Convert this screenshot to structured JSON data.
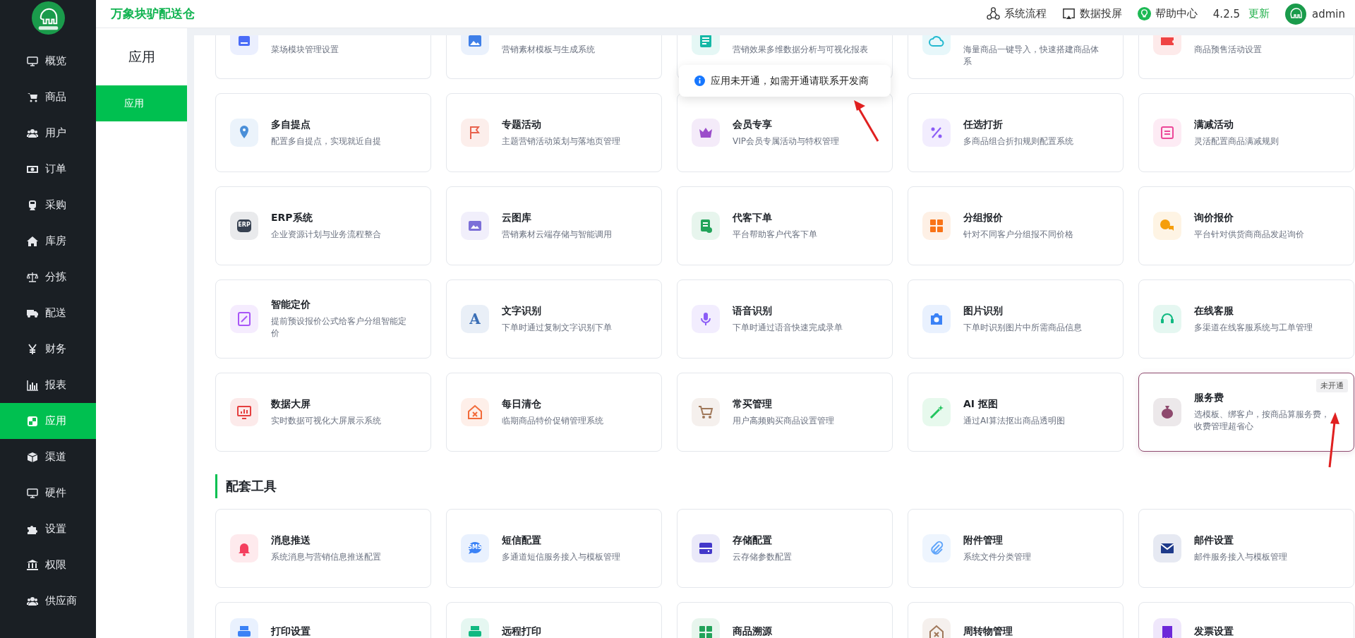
{
  "brand": {
    "title": "万象块驴配送仓"
  },
  "topbar": {
    "links": [
      {
        "label": "系统流程"
      },
      {
        "label": "数据投屏"
      },
      {
        "label": "帮助中心"
      }
    ],
    "version": "4.2.5",
    "update": "更新",
    "user": "admin"
  },
  "sidebar": {
    "items": [
      {
        "label": "概览",
        "selected": false
      },
      {
        "label": "商品",
        "selected": false
      },
      {
        "label": "用户",
        "selected": false
      },
      {
        "label": "订单",
        "selected": false
      },
      {
        "label": "采购",
        "selected": false
      },
      {
        "label": "库房",
        "selected": false
      },
      {
        "label": "分拣",
        "selected": false
      },
      {
        "label": "配送",
        "selected": false
      },
      {
        "label": "财务",
        "selected": false
      },
      {
        "label": "报表",
        "selected": false
      },
      {
        "label": "应用",
        "selected": true
      },
      {
        "label": "渠道",
        "selected": false
      },
      {
        "label": "硬件",
        "selected": false
      },
      {
        "label": "设置",
        "selected": false
      },
      {
        "label": "权限",
        "selected": false
      },
      {
        "label": "供应商",
        "selected": false
      }
    ]
  },
  "subnav": {
    "title": "应用",
    "items": [
      {
        "label": "应用",
        "selected": true
      }
    ]
  },
  "sections": [
    {
      "cards": [
        {
          "description": "菜场模块管理设置",
          "color": "#4a6cf7",
          "clipped": true,
          "highlighted": false
        },
        {
          "description": "营销素材模板与生成系统",
          "color": "#3f7fe8",
          "clipped": true,
          "highlighted": false
        },
        {
          "description": "营销效果多维数据分析与可视化报表",
          "color": "#14b8a6",
          "clipped": true,
          "highlighted": false
        },
        {
          "description": "海量商品一键导入，快速搭建商品体系",
          "color": "#22b8cf",
          "clipped": true,
          "highlighted": false
        },
        {
          "description": "商品预售活动设置",
          "color": "#ef4444",
          "clipped": true,
          "highlighted": false
        },
        {
          "title": "多自提点",
          "description": "配置多自提点，实现就近自提",
          "color": "#4a8fd8",
          "clipped": false,
          "highlighted": false
        },
        {
          "title": "专题活动",
          "description": "主题营销活动策划与落地页管理",
          "color": "#e8614c",
          "clipped": false,
          "highlighted": false
        },
        {
          "title": "会员专享",
          "description": "VIP会员专属活动与特权管理",
          "color": "#9b4dca",
          "clipped": false,
          "highlighted": false
        },
        {
          "title": "任选打折",
          "description": "多商品组合折扣规则配置系统",
          "color": "#8b5cf6",
          "clipped": false,
          "highlighted": false
        },
        {
          "title": "满减活动",
          "description": "灵活配置商品满减规则",
          "color": "#ec4899",
          "clipped": false,
          "highlighted": false
        },
        {
          "title": "ERP系统",
          "description": "企业资源计划与业务流程整合",
          "color": "#374151",
          "icon_text": "ERP",
          "clipped": false,
          "highlighted": false
        },
        {
          "title": "云图库",
          "description": "营销素材云端存储与智能调用",
          "color": "#7c6fd8",
          "clipped": false,
          "highlighted": false
        },
        {
          "title": "代客下单",
          "description": "平台帮助客户代客下单",
          "color": "#22a35a",
          "clipped": false,
          "highlighted": false
        },
        {
          "title": "分组报价",
          "description": "针对不同客户分组报不同价格",
          "color": "#f97316",
          "clipped": false,
          "highlighted": false
        },
        {
          "title": "询价报价",
          "description": "平台针对供货商商品发起询价",
          "color": "#f59e0b",
          "clipped": false,
          "highlighted": false
        },
        {
          "title": "智能定价",
          "description": "提前预设报价公式给客户分组智能定价",
          "color": "#a855f7",
          "clipped": false,
          "highlighted": false
        },
        {
          "title": "文字识别",
          "description": "下单时通过复制文字识别下单",
          "color": "#3b6fb6",
          "icon_text": "A",
          "clipped": false,
          "highlighted": false
        },
        {
          "title": "语音识别",
          "description": "下单时通过语音快速完成录单",
          "color": "#8b5cf6",
          "clipped": false,
          "highlighted": false
        },
        {
          "title": "图片识别",
          "description": "下单时识别图片中所需商品信息",
          "color": "#3b82f6",
          "clipped": false,
          "highlighted": false
        },
        {
          "title": "在线客服",
          "description": "多渠道在线客服系统与工单管理",
          "color": "#10b981",
          "clipped": false,
          "highlighted": false
        },
        {
          "title": "数据大屏",
          "description": "实时数据可视化大屏展示系统",
          "color": "#e53e3e",
          "clipped": false,
          "highlighted": false
        },
        {
          "title": "每日清仓",
          "description": "临期商品特价促销管理系统",
          "color": "#f26b3a",
          "clipped": false,
          "highlighted": false
        },
        {
          "title": "常买管理",
          "description": "用户高频购买商品设置管理",
          "color": "#a0785a",
          "clipped": false,
          "highlighted": false
        },
        {
          "title": "AI 抠图",
          "description": "通过AI算法抠出商品透明图",
          "color": "#22c55e",
          "clipped": false,
          "highlighted": false
        },
        {
          "title": "服务费",
          "description": "选模板、绑客户，按商品算服务费，收费管理超省心",
          "color": "#8e4a6e",
          "badge": "未开通",
          "clipped": false,
          "highlighted": true
        }
      ]
    },
    {
      "heading": "配套工具",
      "cards": [
        {
          "title": "消息推送",
          "description": "系统消息与营销信息推送配置",
          "color": "#f43f5e",
          "clipped": false,
          "highlighted": false
        },
        {
          "title": "短信配置",
          "description": "多通道短信服务接入与模板管理",
          "color": "#3b82f6",
          "icon_text": "SMS",
          "clipped": false,
          "highlighted": false
        },
        {
          "title": "存储配置",
          "description": "云存储参数配置",
          "color": "#4338ca",
          "clipped": false,
          "highlighted": false
        },
        {
          "title": "附件管理",
          "description": "系统文件分类管理",
          "color": "#60a5fa",
          "clipped": false,
          "highlighted": false
        },
        {
          "title": "邮件设置",
          "description": "邮件服务接入与模板管理",
          "color": "#1e3a8a",
          "clipped": false,
          "highlighted": false
        },
        {
          "title": "打印设置",
          "color": "#3b82f6",
          "clipped": false,
          "highlighted": false
        },
        {
          "title": "远程打印",
          "color": "#10b981",
          "clipped": false,
          "highlighted": false
        },
        {
          "title": "商品溯源",
          "color": "#22a35a",
          "clipped": false,
          "highlighted": false
        },
        {
          "title": "周转物管理",
          "color": "#a0785a",
          "clipped": false,
          "highlighted": false
        },
        {
          "title": "发票设置",
          "color": "#6d28d9",
          "clipped": false,
          "highlighted": false
        }
      ]
    }
  ],
  "toast": {
    "text": "应用未开通，如需开通请联系开发商"
  }
}
